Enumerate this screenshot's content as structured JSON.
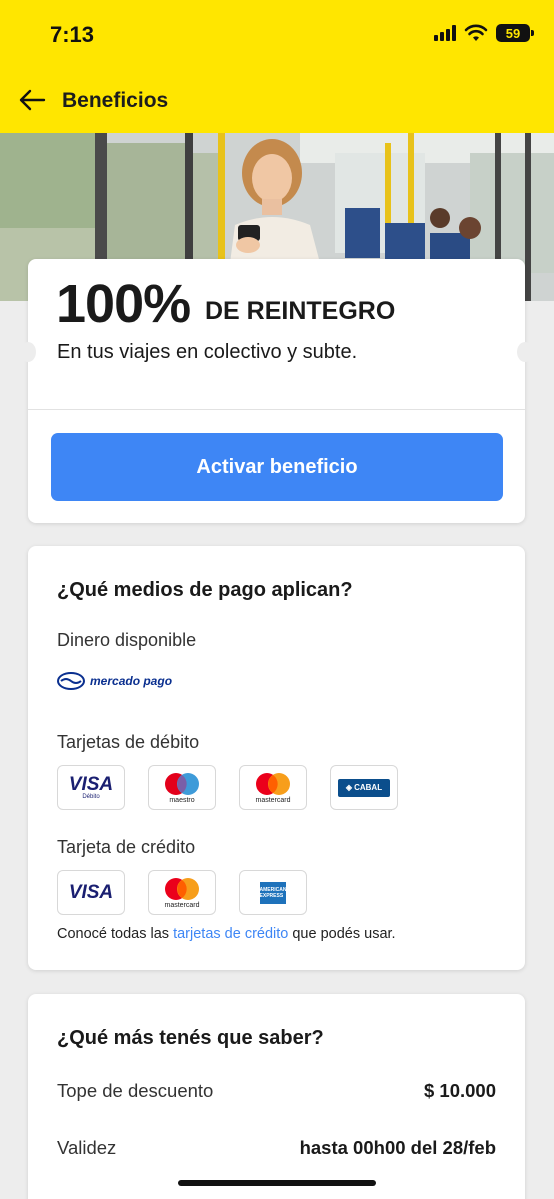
{
  "status_bar": {
    "time": "7:13",
    "battery": "59"
  },
  "header": {
    "title": "Beneficios"
  },
  "promo": {
    "percent": "100%",
    "headline": "DE REINTEGRO",
    "subtitle": "En tus viajes en colectivo y subte.",
    "cta_label": "Activar beneficio"
  },
  "payment": {
    "title": "¿Qué medios de pago aplican?",
    "wallet_label": "Dinero disponible",
    "wallet_logo_text": "mercado pago",
    "debit_label": "Tarjetas de débito",
    "debit_cards": [
      {
        "brand": "VISA",
        "sub": "Débito"
      },
      {
        "brand": "maestro"
      },
      {
        "brand": "mastercard"
      },
      {
        "brand": "CABAL"
      }
    ],
    "credit_label": "Tarjeta de crédito",
    "credit_cards": [
      {
        "brand": "VISA"
      },
      {
        "brand": "mastercard"
      },
      {
        "brand": "AMERICAN EXPRESS"
      }
    ],
    "note_prefix": "Conocé todas las ",
    "note_link": "tarjetas de crédito",
    "note_suffix": " que podés usar."
  },
  "more_info": {
    "title": "¿Qué más tenés que saber?",
    "rows": [
      {
        "label": "Tope de descuento",
        "value": "$ 10.000"
      },
      {
        "label": "Validez",
        "value": "hasta 00h00 del 28/feb"
      }
    ]
  },
  "colors": {
    "header_bg": "#ffe600",
    "cta_bg": "#3e86f5",
    "link": "#3e86f5"
  },
  "icons": [
    "back-arrow-icon",
    "signal-icon",
    "wifi-icon",
    "battery-icon",
    "mercado-pago-logo-icon"
  ]
}
